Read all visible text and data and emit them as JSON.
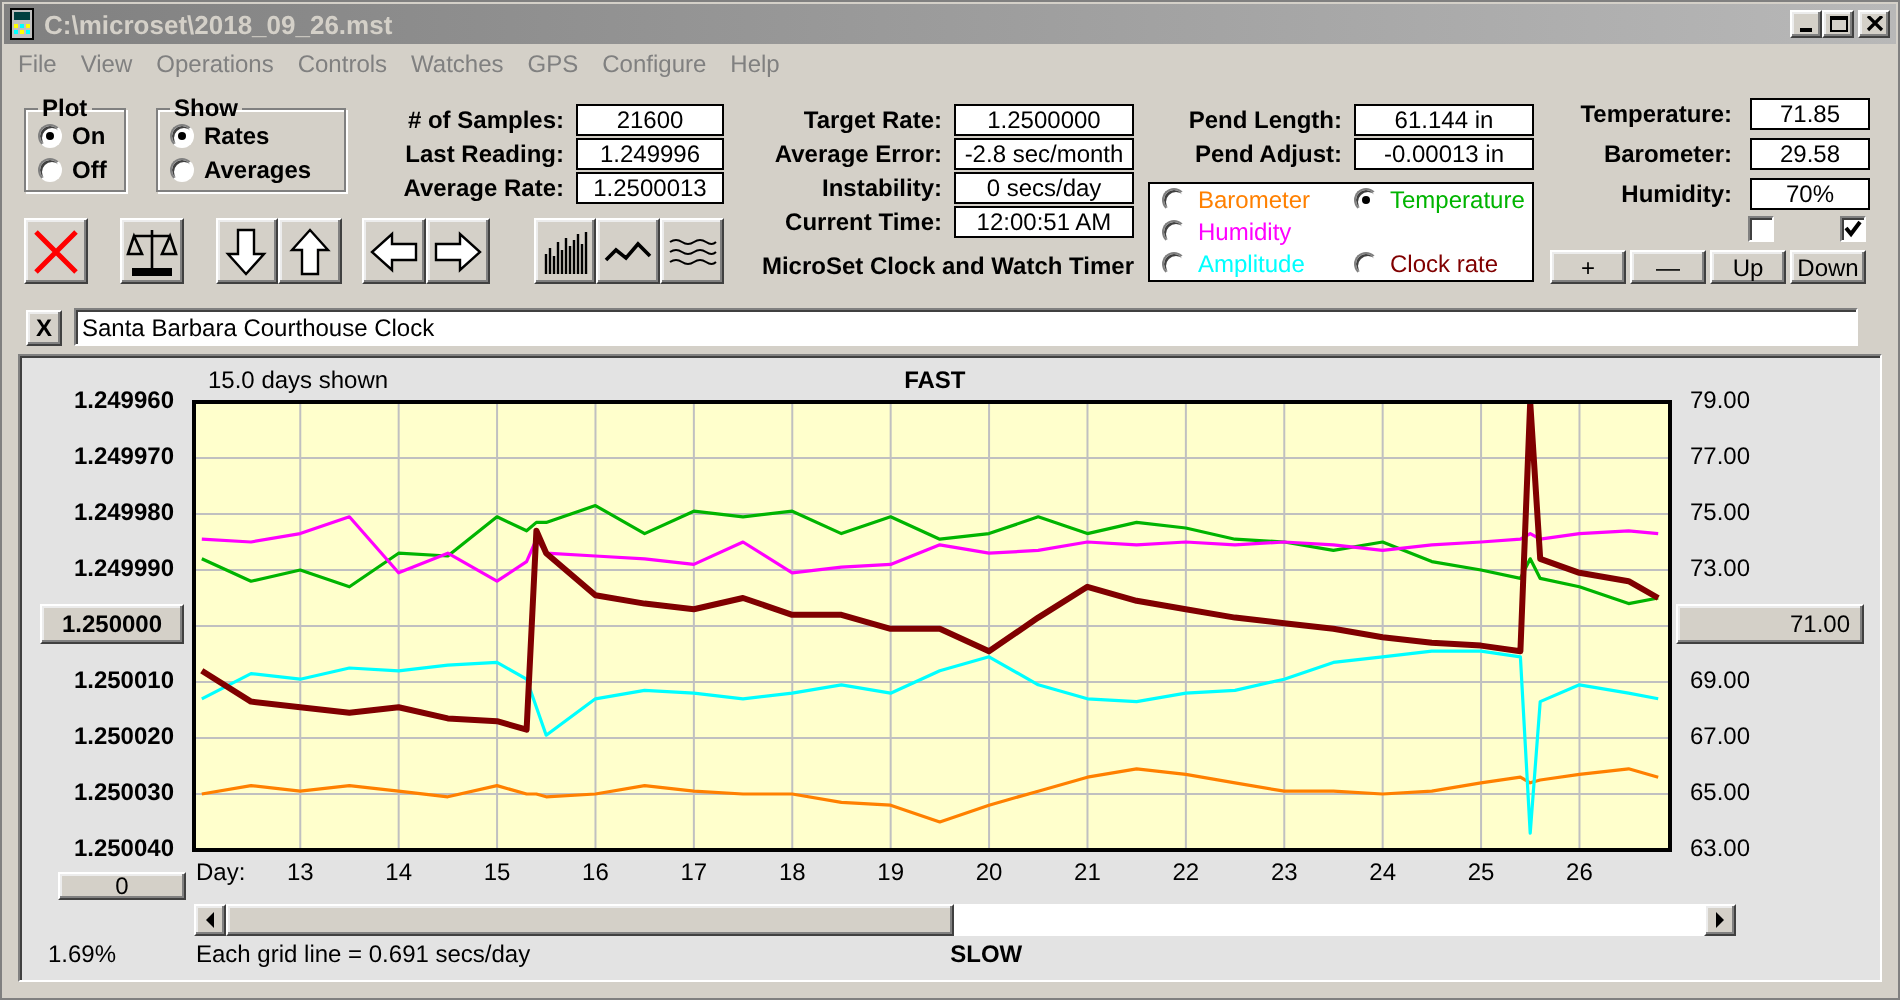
{
  "window": {
    "title": "C:\\microset\\2018_09_26.mst"
  },
  "menu": [
    "File",
    "View",
    "Operations",
    "Controls",
    "Watches",
    "GPS",
    "Configure",
    "Help"
  ],
  "plot": {
    "title": "Plot",
    "options": [
      {
        "label": "On",
        "selected": true
      },
      {
        "label": "Off",
        "selected": false
      }
    ]
  },
  "show": {
    "title": "Show",
    "options": [
      {
        "label": "Rates",
        "selected": true
      },
      {
        "label": "Averages",
        "selected": false
      }
    ]
  },
  "stats": [
    {
      "label": "# of Samples:",
      "value": "21600"
    },
    {
      "label": "Last Reading:",
      "value": "1.249996"
    },
    {
      "label": "Average Rate:",
      "value": "1.2500013"
    }
  ],
  "rates": [
    {
      "label": "Target Rate:",
      "value": "1.2500000"
    },
    {
      "label": "Average Error:",
      "value": "-2.8 sec/month"
    },
    {
      "label": "Instability:",
      "value": "0 secs/day"
    },
    {
      "label": "Current Time:",
      "value": "12:00:51 AM"
    }
  ],
  "app_title": "MicroSet Clock and Watch Timer",
  "pendulum": [
    {
      "label": "Pend Length:",
      "value": "61.144 in"
    },
    {
      "label": "Pend Adjust:",
      "value": "-0.00013 in"
    }
  ],
  "series_selector": [
    {
      "selected": false
    },
    {
      "selected": true
    },
    {
      "selected": false
    },
    {
      "selected": false
    },
    {
      "selected": false
    }
  ],
  "environment": [
    {
      "label": "Temperature:",
      "value": "71.85"
    },
    {
      "label": "Barometer:",
      "value": "29.58"
    },
    {
      "label": "Humidity:",
      "value": "70%"
    }
  ],
  "checkboxes": [
    {
      "checked": false
    },
    {
      "checked": true
    }
  ],
  "adjust_buttons": [
    "+",
    "—",
    "Up",
    "Down"
  ],
  "toolbar": [
    {
      "kind": "clear"
    },
    {
      "kind": "balance"
    },
    {
      "kind": "down"
    },
    {
      "kind": "up"
    },
    {
      "kind": "left"
    },
    {
      "kind": "right"
    },
    {
      "kind": "bars"
    },
    {
      "kind": "zigzag"
    },
    {
      "kind": "waves"
    }
  ],
  "note": {
    "clear_button": "X",
    "value": "Santa Barbara Courthouse Clock"
  },
  "chart": {
    "days_shown": "15.0 days shown",
    "top_label": "FAST",
    "bottom_label": "SLOW",
    "grid_note": "Each grid line = 0.691 secs/day",
    "percent": "1.69%",
    "offset_button": "0",
    "center_rate_button": "1.250000",
    "center_value_button": "71.00",
    "chart_data": {
      "type": "line",
      "xlabel": "Day:",
      "xlim": [
        11.92,
        26.92
      ],
      "ylim": [
        1.25004,
        1.24996
      ],
      "y2lim": [
        63,
        79
      ],
      "grid": true,
      "x": [
        12.0,
        12.5,
        13,
        13.5,
        14,
        14.5,
        15,
        15.3,
        15.4,
        15.5,
        16,
        16.5,
        17,
        17.5,
        18,
        18.5,
        19,
        19.5,
        20,
        20.5,
        21,
        21.5,
        22,
        22.5,
        23,
        23.5,
        24,
        24.5,
        25,
        25.4,
        25.5,
        25.6,
        26,
        26.5,
        26.8
      ],
      "xticks": [
        {
          "value": 13,
          "label": "13"
        },
        {
          "value": 14,
          "label": "14"
        },
        {
          "value": 15,
          "label": "15"
        },
        {
          "value": 16,
          "label": "16"
        },
        {
          "value": 17,
          "label": "17"
        },
        {
          "value": 18,
          "label": "18"
        },
        {
          "value": 19,
          "label": "19"
        },
        {
          "value": 20,
          "label": "20"
        },
        {
          "value": 21,
          "label": "21"
        },
        {
          "value": 22,
          "label": "22"
        },
        {
          "value": 23,
          "label": "23"
        },
        {
          "value": 24,
          "label": "24"
        },
        {
          "value": 25,
          "label": "25"
        },
        {
          "value": 26,
          "label": "26"
        }
      ],
      "yticks": [
        {
          "value": 1.24996,
          "label": "1.249960"
        },
        {
          "value": 1.24997,
          "label": "1.249970"
        },
        {
          "value": 1.24998,
          "label": "1.249980"
        },
        {
          "value": 1.24999,
          "label": "1.249990"
        },
        {
          "value": 1.25001,
          "label": "1.250010"
        },
        {
          "value": 1.25002,
          "label": "1.250020"
        },
        {
          "value": 1.25003,
          "label": "1.250030"
        },
        {
          "value": 1.25004,
          "label": "1.250040"
        }
      ],
      "y2ticks": [
        {
          "value": 79,
          "label": "79.00"
        },
        {
          "value": 77,
          "label": "77.00"
        },
        {
          "value": 75,
          "label": "75.00"
        },
        {
          "value": 73,
          "label": "73.00"
        },
        {
          "value": 69,
          "label": "69.00"
        },
        {
          "value": 67,
          "label": "67.00"
        },
        {
          "value": 65,
          "label": "65.00"
        },
        {
          "value": 63,
          "label": "63.00"
        }
      ],
      "series": [
        {
          "name": "Barometer",
          "color": "#ff8000",
          "values": [
            1.25003,
            1.2500285,
            1.2500295,
            1.2500285,
            1.2500295,
            1.2500305,
            1.2500285,
            1.25003,
            1.25003,
            1.2500305,
            1.25003,
            1.2500285,
            1.2500295,
            1.25003,
            1.25003,
            1.2500315,
            1.250032,
            1.250035,
            1.250032,
            1.2500295,
            1.250027,
            1.2500255,
            1.2500265,
            1.250028,
            1.2500295,
            1.2500295,
            1.25003,
            1.2500295,
            1.250028,
            1.250027,
            1.250028,
            1.2500275,
            1.2500265,
            1.2500255,
            1.250027
          ]
        },
        {
          "name": "Temperature",
          "color": "#00b400",
          "values": [
            1.249988,
            1.249992,
            1.24999,
            1.249993,
            1.249987,
            1.2499875,
            1.2499805,
            1.249983,
            1.2499815,
            1.2499815,
            1.2499785,
            1.2499835,
            1.2499795,
            1.2499805,
            1.2499795,
            1.2499835,
            1.2499805,
            1.2499845,
            1.2499835,
            1.2499805,
            1.2499835,
            1.2499815,
            1.2499825,
            1.2499845,
            1.249985,
            1.2499865,
            1.249985,
            1.2499885,
            1.24999,
            1.2499915,
            1.249988,
            1.2499915,
            1.249993,
            1.249996,
            1.249995
          ]
        },
        {
          "name": "Humidity",
          "color": "#ff00ff",
          "values": [
            1.2499845,
            1.249985,
            1.2499835,
            1.2499805,
            1.2499905,
            1.249987,
            1.249992,
            1.2499885,
            1.2499845,
            1.249987,
            1.2499875,
            1.249988,
            1.249989,
            1.249985,
            1.2499905,
            1.2499895,
            1.249989,
            1.2499855,
            1.249987,
            1.2499865,
            1.249985,
            1.2499855,
            1.249985,
            1.2499855,
            1.249985,
            1.2499855,
            1.2499865,
            1.2499855,
            1.249985,
            1.2499845,
            1.2499835,
            1.2499845,
            1.2499835,
            1.249983,
            1.2499835
          ]
        },
        {
          "name": "Amplitude",
          "color": "#00ffff",
          "values": [
            1.250013,
            1.2500085,
            1.2500095,
            1.2500075,
            1.250008,
            1.250007,
            1.2500065,
            1.2500095,
            1.2500145,
            1.2500195,
            1.250013,
            1.2500115,
            1.250012,
            1.250013,
            1.250012,
            1.2500105,
            1.250012,
            1.250008,
            1.2500055,
            1.2500105,
            1.250013,
            1.2500135,
            1.250012,
            1.2500115,
            1.2500095,
            1.2500065,
            1.2500055,
            1.2500045,
            1.2500045,
            1.2500055,
            1.250037,
            1.2500135,
            1.2500105,
            1.250012,
            1.250013
          ]
        },
        {
          "name": "Clock rate",
          "color": "#800000",
          "values": [
            1.250008,
            1.2500135,
            1.2500145,
            1.2500155,
            1.2500145,
            1.2500165,
            1.250017,
            1.2500185,
            1.249983,
            1.249987,
            1.2499945,
            1.249996,
            1.249997,
            1.249995,
            1.249998,
            1.249998,
            1.2500005,
            1.2500005,
            1.2500045,
            1.2499985,
            1.249993,
            1.2499955,
            1.249997,
            1.2499985,
            1.2499995,
            1.2500005,
            1.250002,
            1.250003,
            1.2500035,
            1.2500045,
            1.24996,
            1.249988,
            1.2499905,
            1.249992,
            1.249995
          ]
        }
      ]
    }
  }
}
